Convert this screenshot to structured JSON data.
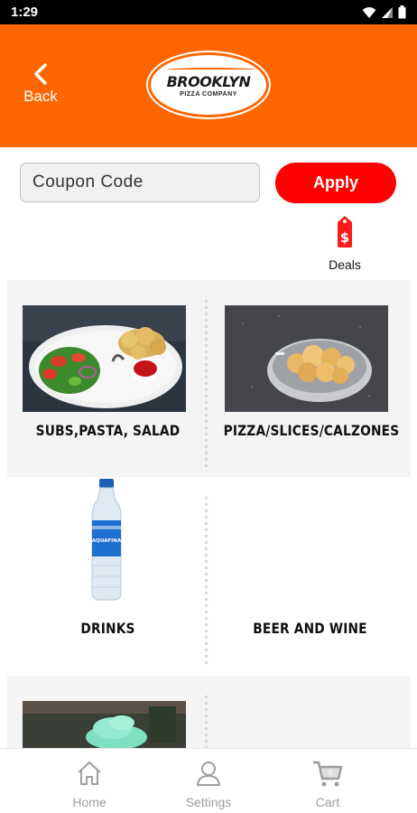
{
  "status_bar": {
    "time": "1:29"
  },
  "header": {
    "back_label": "Back",
    "logo_text": "BROOKLYN",
    "logo_subtext": "PIZZA COMPANY"
  },
  "coupon": {
    "placeholder": "Coupon Code",
    "apply_label": "Apply"
  },
  "deals": {
    "label": "Deals",
    "icon": "price-tag-dollar-icon"
  },
  "categories": [
    {
      "label": "SUBS,PASTA, SALAD"
    },
    {
      "label": "PIZZA/SLICES/CALZONES"
    },
    {
      "label": "DRINKS"
    },
    {
      "label": "BEER AND WINE"
    }
  ],
  "bottom_nav": [
    {
      "label": "Home",
      "icon": "home-icon"
    },
    {
      "label": "Settings",
      "icon": "user-icon"
    },
    {
      "label": "Cart",
      "icon": "cart-icon"
    }
  ],
  "colors": {
    "header": "#ff6600",
    "apply_button": "#ff0000",
    "deals_icon": "#ff1a1a"
  }
}
